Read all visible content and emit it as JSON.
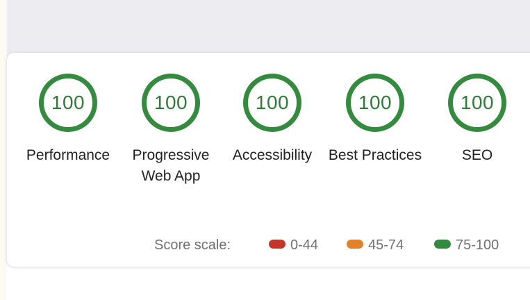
{
  "categories": [
    {
      "score": "100",
      "label": "Performance"
    },
    {
      "score": "100",
      "label": "Progressive Web App"
    },
    {
      "score": "100",
      "label": "Accessibility"
    },
    {
      "score": "100",
      "label": "Best Practices"
    },
    {
      "score": "100",
      "label": "SEO"
    }
  ],
  "score_scale": {
    "title": "Score scale:",
    "ranges": [
      {
        "label": "0-44",
        "color": "#c4362c"
      },
      {
        "label": "45-74",
        "color": "#e0812b"
      },
      {
        "label": "75-100",
        "color": "#348a3e"
      }
    ]
  },
  "colors": {
    "pass": "#348a3e"
  }
}
